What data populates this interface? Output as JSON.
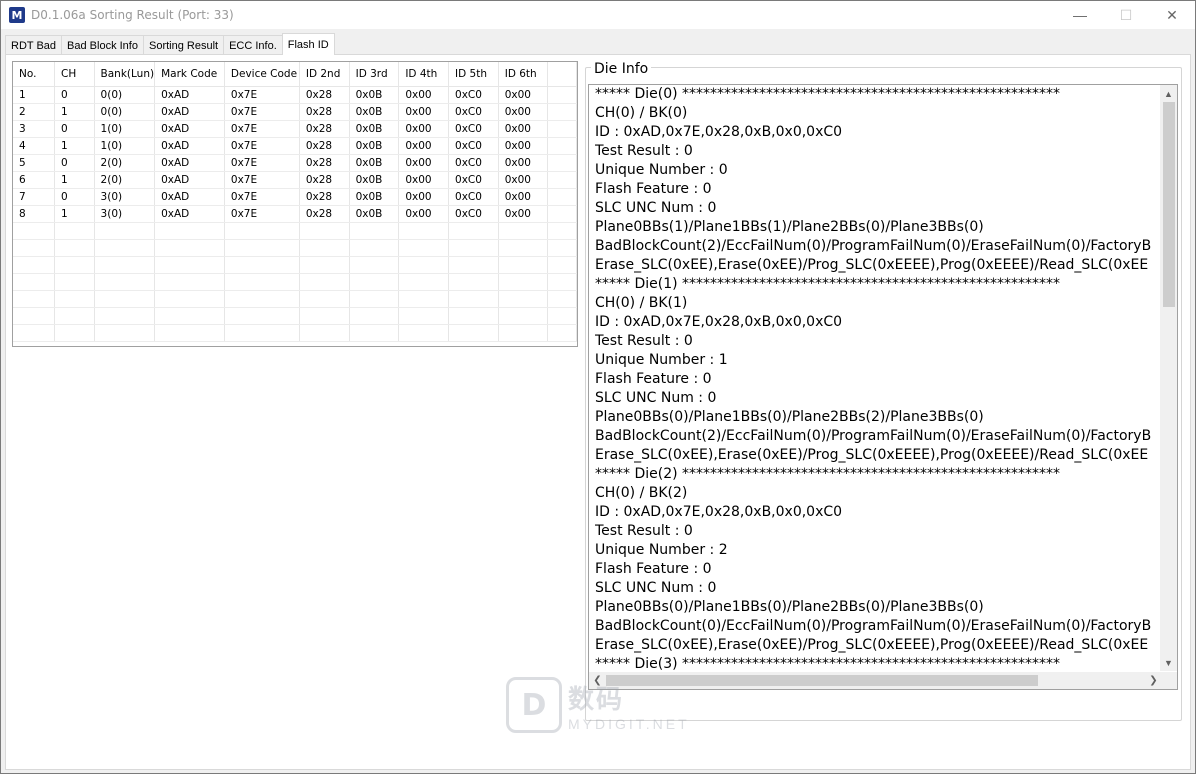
{
  "window": {
    "title": "D0.1.06a Sorting Result (Port: 33)",
    "icon_letter": "M"
  },
  "window_controls": {
    "minimize": "—",
    "maximize": "☐",
    "close": "✕"
  },
  "tabs": [
    {
      "label": "RDT Bad",
      "active": false
    },
    {
      "label": "Bad Block Info",
      "active": false
    },
    {
      "label": "Sorting Result",
      "active": false
    },
    {
      "label": "ECC Info.",
      "active": false
    },
    {
      "label": "Flash ID",
      "active": true
    }
  ],
  "flash_table": {
    "columns": [
      "No.",
      "CH",
      "Bank(Lun)",
      "Mark Code",
      "Device Code",
      "ID 2nd",
      "ID 3rd",
      "ID 4th",
      "ID 5th",
      "ID 6th",
      ""
    ],
    "rows": [
      [
        "1",
        "0",
        "0(0)",
        "0xAD",
        "0x7E",
        "0x28",
        "0x0B",
        "0x00",
        "0xC0",
        "0x00",
        ""
      ],
      [
        "2",
        "1",
        "0(0)",
        "0xAD",
        "0x7E",
        "0x28",
        "0x0B",
        "0x00",
        "0xC0",
        "0x00",
        ""
      ],
      [
        "3",
        "0",
        "1(0)",
        "0xAD",
        "0x7E",
        "0x28",
        "0x0B",
        "0x00",
        "0xC0",
        "0x00",
        ""
      ],
      [
        "4",
        "1",
        "1(0)",
        "0xAD",
        "0x7E",
        "0x28",
        "0x0B",
        "0x00",
        "0xC0",
        "0x00",
        ""
      ],
      [
        "5",
        "0",
        "2(0)",
        "0xAD",
        "0x7E",
        "0x28",
        "0x0B",
        "0x00",
        "0xC0",
        "0x00",
        ""
      ],
      [
        "6",
        "1",
        "2(0)",
        "0xAD",
        "0x7E",
        "0x28",
        "0x0B",
        "0x00",
        "0xC0",
        "0x00",
        ""
      ],
      [
        "7",
        "0",
        "3(0)",
        "0xAD",
        "0x7E",
        "0x28",
        "0x0B",
        "0x00",
        "0xC0",
        "0x00",
        ""
      ],
      [
        "8",
        "1",
        "3(0)",
        "0xAD",
        "0x7E",
        "0x28",
        "0x0B",
        "0x00",
        "0xC0",
        "0x00",
        ""
      ]
    ],
    "empty_rows": 7
  },
  "die_info": {
    "label": "Die Info",
    "lines": [
      "***** Die(0) ******************************************************",
      "CH(0) / BK(0)",
      "ID : 0xAD,0x7E,0x28,0xB,0x0,0xC0",
      "Test Result : 0",
      "Unique Number : 0",
      "Flash Feature : 0",
      "SLC UNC Num : 0",
      "Plane0BBs(1)/Plane1BBs(1)/Plane2BBs(0)/Plane3BBs(0)",
      "BadBlockCount(2)/EccFailNum(0)/ProgramFailNum(0)/EraseFailNum(0)/FactoryB",
      "Erase_SLC(0xEE),Erase(0xEE)/Prog_SLC(0xEEEE),Prog(0xEEEE)/Read_SLC(0xEE",
      "***** Die(1) ******************************************************",
      "CH(0) / BK(1)",
      "ID : 0xAD,0x7E,0x28,0xB,0x0,0xC0",
      "Test Result : 0",
      "Unique Number : 1",
      "Flash Feature : 0",
      "SLC UNC Num : 0",
      "Plane0BBs(0)/Plane1BBs(0)/Plane2BBs(2)/Plane3BBs(0)",
      "BadBlockCount(2)/EccFailNum(0)/ProgramFailNum(0)/EraseFailNum(0)/FactoryB",
      "Erase_SLC(0xEE),Erase(0xEE)/Prog_SLC(0xEEEE),Prog(0xEEEE)/Read_SLC(0xEE",
      "***** Die(2) ******************************************************",
      "CH(0) / BK(2)",
      "ID : 0xAD,0x7E,0x28,0xB,0x0,0xC0",
      "Test Result : 0",
      "Unique Number : 2",
      "Flash Feature : 0",
      "SLC UNC Num : 0",
      "Plane0BBs(0)/Plane1BBs(0)/Plane2BBs(0)/Plane3BBs(0)",
      "BadBlockCount(0)/EccFailNum(0)/ProgramFailNum(0)/EraseFailNum(0)/FactoryB",
      "Erase_SLC(0xEE),Erase(0xEE)/Prog_SLC(0xEEEE),Prog(0xEEEE)/Read_SLC(0xEE",
      "***** Die(3) ******************************************************"
    ]
  },
  "watermark": {
    "logo": "D",
    "text_big": "数码",
    "text_small": "MYDIGIT.NET"
  }
}
